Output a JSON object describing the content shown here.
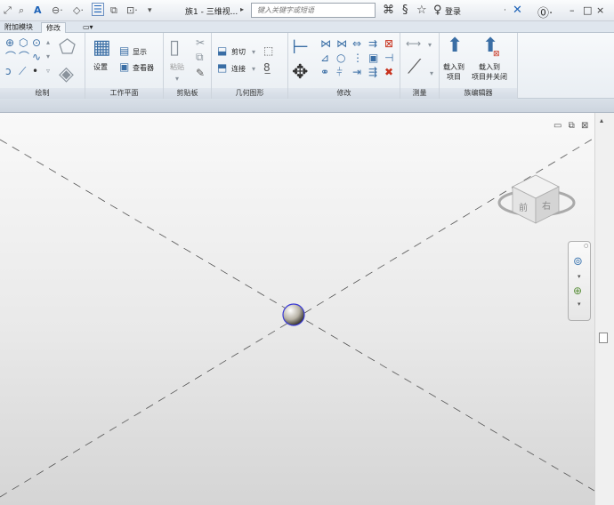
{
  "titlebar": {
    "document_title": "族1 - 三维视...",
    "search_placeholder": "键入关键字或短语",
    "login_label": "登录"
  },
  "tabs": [
    {
      "label": "附加模块"
    },
    {
      "label": "修改"
    },
    {
      "label": "▭▾"
    }
  ],
  "ribbon": {
    "panels": [
      {
        "label": "绘制"
      },
      {
        "label": "工作平面"
      },
      {
        "label": "剪贴板"
      },
      {
        "label": "几何图形"
      },
      {
        "label": "修改"
      },
      {
        "label": "测量"
      },
      {
        "label": "族编辑器"
      }
    ],
    "workplane": {
      "set": "设置",
      "show": "显示",
      "viewer": "查看器"
    },
    "clipboard": {
      "paste": "粘贴"
    },
    "geometry": {
      "cut": "剪切",
      "join": "连接"
    },
    "family_editor": {
      "load_into_project": "载入到\n项目",
      "load_and_close": "载入到\n项目并关闭"
    }
  },
  "viewcube": {
    "front": "前",
    "right": "右"
  }
}
